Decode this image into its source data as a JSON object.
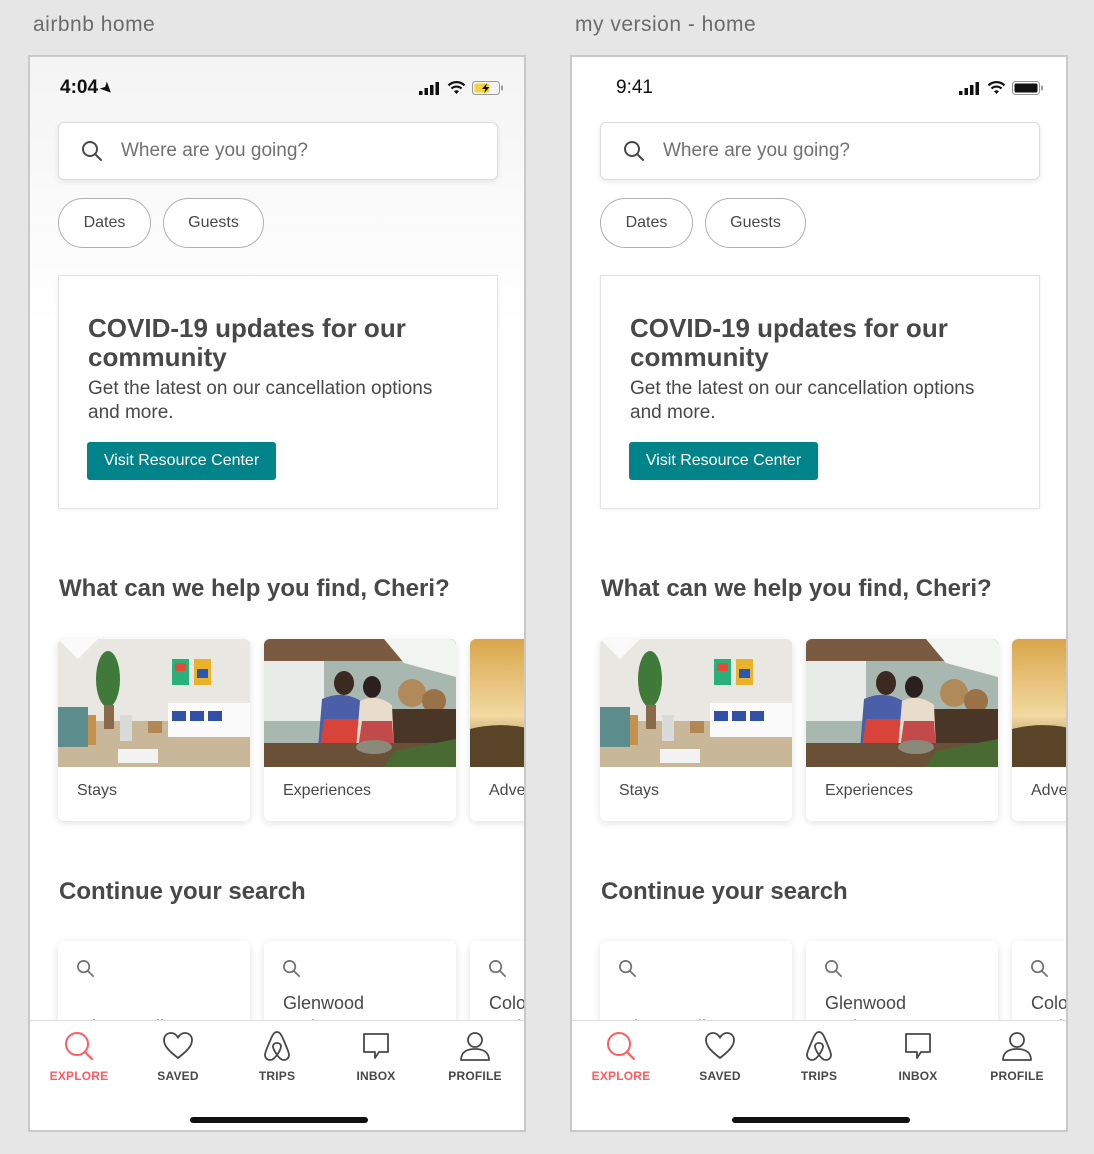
{
  "captions": {
    "left": "airbnb home",
    "right": "my version - home"
  },
  "colors": {
    "teal": "#008489",
    "coral": "#ff5a5f",
    "text": "#484848"
  },
  "phones": {
    "left": {
      "time": "4:04",
      "search_placeholder": "Where are you going?",
      "filters": {
        "dates": "Dates",
        "guests": "Guests"
      },
      "covid": {
        "title": "COVID-19 updates for our community",
        "body": "Get the latest on our cancellation options and more.",
        "button": "Visit Resource Center"
      },
      "find_title": "What can we help you find, Cheri?",
      "categories": [
        "Stays",
        "Experiences",
        "Adve"
      ],
      "continue_title": "Continue your search",
      "recent_searches": [
        "Minneapolis, MN",
        "Glenwood Springs, CO",
        "Colo Springs"
      ],
      "tabs": [
        "EXPLORE",
        "SAVED",
        "TRIPS",
        "INBOX",
        "PROFILE"
      ]
    },
    "right": {
      "time": "9:41",
      "search_placeholder": "Where are you going?",
      "filters": {
        "dates": "Dates",
        "guests": "Guests"
      },
      "covid": {
        "title": "COVID-19 updates for our community",
        "body": "Get the latest on our cancellation options and more.",
        "button": "Visit Resource Center"
      },
      "find_title": "What can we help you find, Cheri?",
      "categories": [
        "Stays",
        "Experiences",
        "Adve"
      ],
      "continue_title": "Continue your search",
      "recent_searches": [
        "Minneapolis, MN",
        "Glenwood Springs, CO",
        "Colo Springs"
      ],
      "tabs": [
        "EXPLORE",
        "SAVED",
        "TRIPS",
        "INBOX",
        "PROFILE"
      ]
    }
  }
}
